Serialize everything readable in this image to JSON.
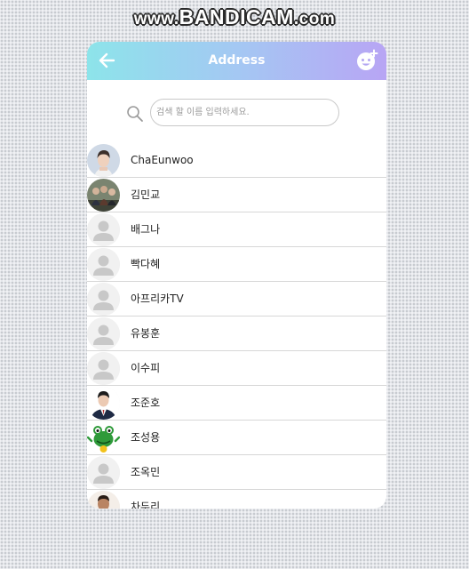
{
  "watermark": {
    "prefix": "www.",
    "brand": "BANDICAM",
    "suffix": ".com"
  },
  "header": {
    "title": "Address",
    "back_icon": "arrow-left-icon",
    "add_icon": "add-friend-face-icon",
    "gradient": [
      "#8de4ea",
      "#a4c8f3",
      "#b8a5f4"
    ]
  },
  "search": {
    "icon": "search-icon",
    "value": "",
    "placeholder": "검색 할 이름 입력하세요."
  },
  "contacts": [
    {
      "name": "ChaEunwoo",
      "avatar": "photo-person"
    },
    {
      "name": "김민교",
      "avatar": "photo-group"
    },
    {
      "name": "배그나",
      "avatar": "default-person"
    },
    {
      "name": "빡다혜",
      "avatar": "default-person"
    },
    {
      "name": "아프리카TV",
      "avatar": "default-person"
    },
    {
      "name": "유봉훈",
      "avatar": "default-person"
    },
    {
      "name": "이수피",
      "avatar": "default-person"
    },
    {
      "name": "조준호",
      "avatar": "photo-suit"
    },
    {
      "name": "조성용",
      "avatar": "frog-character"
    },
    {
      "name": "조옥민",
      "avatar": "default-person"
    },
    {
      "name": "차두리",
      "avatar": "photo-red"
    }
  ]
}
